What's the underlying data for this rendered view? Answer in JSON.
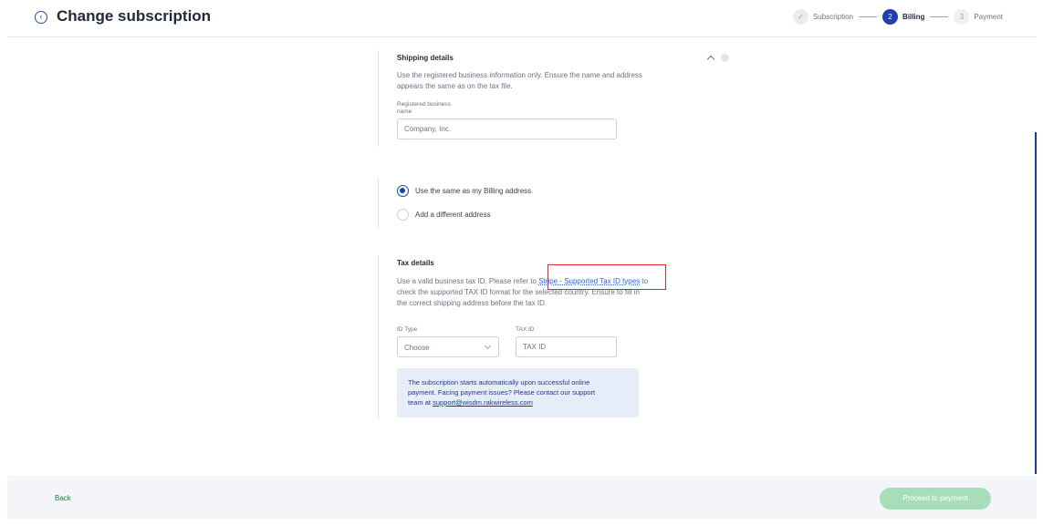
{
  "header": {
    "title": "Change subscription",
    "steps": [
      {
        "number": "✓",
        "label": "Subscription"
      },
      {
        "number": "2",
        "label": "Billing"
      },
      {
        "number": "3",
        "label": "Payment"
      }
    ]
  },
  "shipping": {
    "title": "Shipping details",
    "desc_line1": "Use the registered business information only. Ensure the name and address",
    "desc_line2": "appears the same as on the tax file.",
    "label_line1": "Registered business",
    "label_line2": "name",
    "placeholder": "Company, Inc."
  },
  "address_options": {
    "same": "Use the same as my Billing address",
    "different": "Add a different address"
  },
  "tax": {
    "title": "Tax details",
    "desc_prefix": "Use a valid business tax ID. Please refer to ",
    "link_text": "Stripe - Supported Tax ID types",
    "desc_suffix": " to",
    "desc_line2": "check the supported TAX ID format for the selected country. Ensure to fill in",
    "desc_line3": "the correct shipping address before the tax ID.",
    "id_type_label": "ID Type",
    "id_type_value": "Choose",
    "tax_id_label": "TAX ID",
    "tax_id_placeholder": "TAX ID"
  },
  "info": {
    "line1": "The subscription starts automatically upon successful online",
    "line2": "payment. Facing payment issues? Please contact our support",
    "line3_prefix": "team at ",
    "email": "support@wisdm.rakwireless.com"
  },
  "footer": {
    "back_label": "Back",
    "proceed_label": "Proceed to payment"
  }
}
